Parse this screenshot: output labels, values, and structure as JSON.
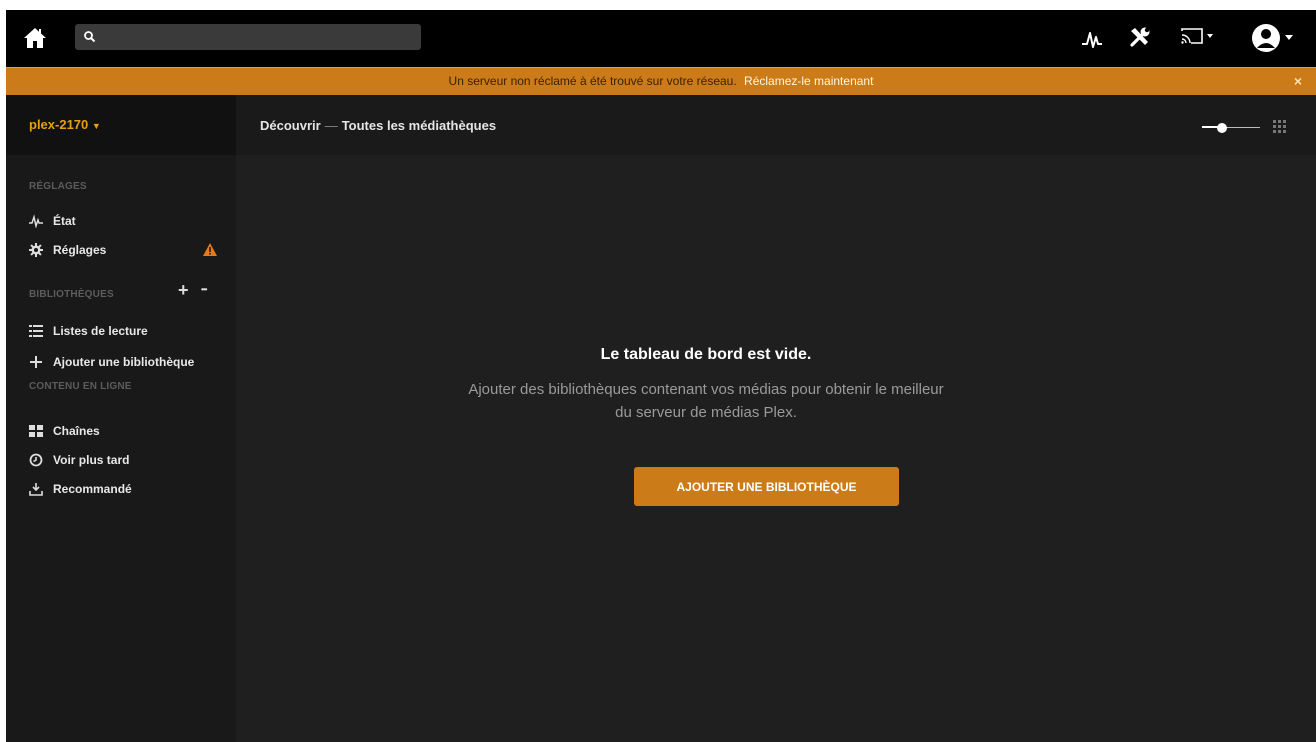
{
  "search": {
    "placeholder": "",
    "value": ""
  },
  "topbar": {
    "icons": [
      "home-icon",
      "search-icon",
      "activity-icon",
      "tools-icon",
      "cast-icon",
      "user-avatar-icon"
    ]
  },
  "banner": {
    "message": "Un serveur non réclamé à été trouvé sur votre réseau.",
    "link": "Réclamez-le maintenant",
    "close": "×"
  },
  "sidebar": {
    "server_name": "plex-2170",
    "sections": {
      "settings": "RÉGLAGES",
      "libraries": "BIBLIOTHÈQUES",
      "online": "CONTENU EN LIGNE"
    },
    "items": {
      "status": "État",
      "settings": "Réglages",
      "playlists": "Listes de lecture",
      "add_library": "Ajouter une bibliothèque",
      "channels": "Chaînes",
      "watch_later": "Voir plus tard",
      "recommended": "Recommandé"
    },
    "library_controls": {
      "add": "+",
      "more": "•••"
    }
  },
  "main": {
    "breadcrumb": {
      "part1": "Découvrir",
      "separator": "—",
      "part2": "Toutes les médiathèques"
    },
    "empty_title": "Le tableau de bord est vide.",
    "empty_desc_line1": "Ajouter des bibliothèques contenant vos médias pour obtenir le meilleur",
    "empty_desc_line2": "du serveur de médias Plex.",
    "cta": "AJOUTER UNE BIBLIOTHÈQUE"
  },
  "colors": {
    "accent": "#cc7b19",
    "server_name": "#e5a00d",
    "sidebar_bg": "#191919",
    "main_bg": "#1f1f1f"
  }
}
